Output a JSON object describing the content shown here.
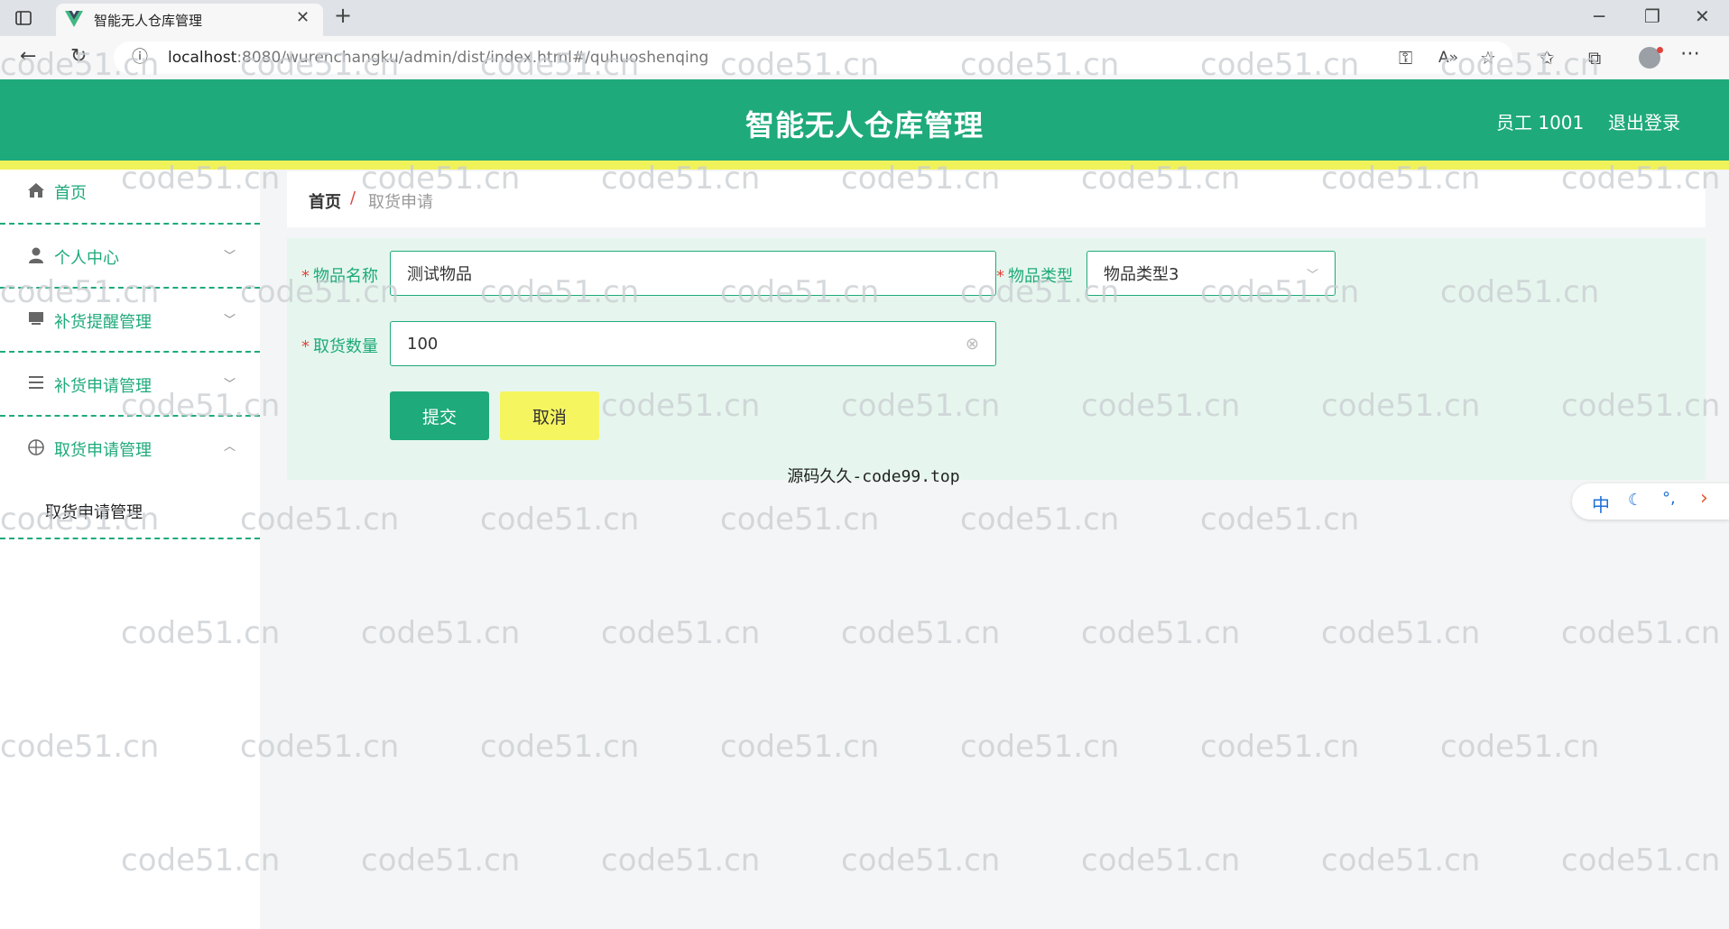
{
  "browser": {
    "tab_title": "智能无人仓库管理",
    "url_host": "localhost",
    "url_rest": ":8080/wurenchangku/admin/dist/index.html#/quhuoshenqing"
  },
  "header": {
    "title": "智能无人仓库管理",
    "user_label": "员工 1001",
    "logout_label": "退出登录"
  },
  "sidebar": {
    "items": [
      {
        "label": "首页",
        "icon": "home-icon"
      },
      {
        "label": "个人中心",
        "icon": "user-icon",
        "expandable": true
      },
      {
        "label": "补货提醒管理",
        "icon": "inbox-icon",
        "expandable": true
      },
      {
        "label": "补货申请管理",
        "icon": "list-icon",
        "expandable": true
      },
      {
        "label": "取货申请管理",
        "icon": "compass-icon",
        "expandable": true,
        "expanded": true
      }
    ],
    "submenu": {
      "label": "取货申请管理"
    }
  },
  "breadcrumb": {
    "home": "首页",
    "separator": "/",
    "current": "取货申请"
  },
  "form": {
    "name_label": "物品名称",
    "name_value": "测试物品",
    "type_label": "物品类型",
    "type_value": "物品类型3",
    "qty_label": "取货数量",
    "qty_value": "100",
    "required_mark": "*",
    "submit_label": "提交",
    "cancel_label": "取消"
  },
  "footer_text": "源码久久-code99.top",
  "ime": {
    "mode": "中"
  },
  "watermark": "code51.cn",
  "colors": {
    "primary": "#1eaa7a",
    "accent_yellow": "#f0f25a",
    "cancel_bg": "#f5f560"
  }
}
